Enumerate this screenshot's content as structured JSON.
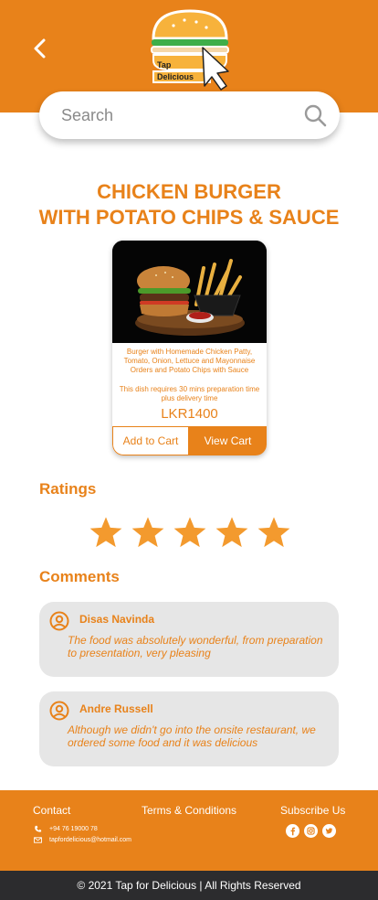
{
  "colors": {
    "brand_orange": "#e8821a",
    "comment_bg": "#e6e6e6",
    "copyright_bg": "#2c2c2e"
  },
  "header": {
    "back_icon": "chevron-left-icon",
    "logo_text_line1": "Tap",
    "logo_text_line2": "Delicious"
  },
  "search": {
    "placeholder": "Search",
    "value": "",
    "icon": "search-icon"
  },
  "product": {
    "title_line1": "CHICKEN BURGER",
    "title_line2": "WITH POTATO CHIPS & SAUCE",
    "description": "Burger with Homemade Chicken Patty, Tomato, Onion, Lettuce and Mayonnaise Orders and Potato Chips with Sauce",
    "prep_note": "This dish requires 30 mins preparation time plus delivery time",
    "price": "LKR1400",
    "add_to_cart_label": "Add to Cart",
    "view_cart_label": "View Cart"
  },
  "ratings": {
    "heading": "Ratings",
    "stars_filled": 5,
    "stars_total": 5
  },
  "comments": {
    "heading": "Comments",
    "items": [
      {
        "name": "Disas Navinda",
        "text": "The food was absolutely wonderful, from preparation to presentation, very pleasing"
      },
      {
        "name": "Andre Russell",
        "text": "Although we didn't go into the onsite restaurant, we ordered some food and it was delicious"
      }
    ]
  },
  "footer": {
    "contact_label": "Contact",
    "terms_label": "Terms & Conditions",
    "subscribe_label": "Subscribe Us",
    "phone": "+94 76 19000 78",
    "email": "tapfordelicious@hotmail.com",
    "social_icons": [
      "facebook-icon",
      "instagram-icon",
      "twitter-icon"
    ]
  },
  "copyright": "© 2021 Tap for Delicious | All Rights Reserved"
}
